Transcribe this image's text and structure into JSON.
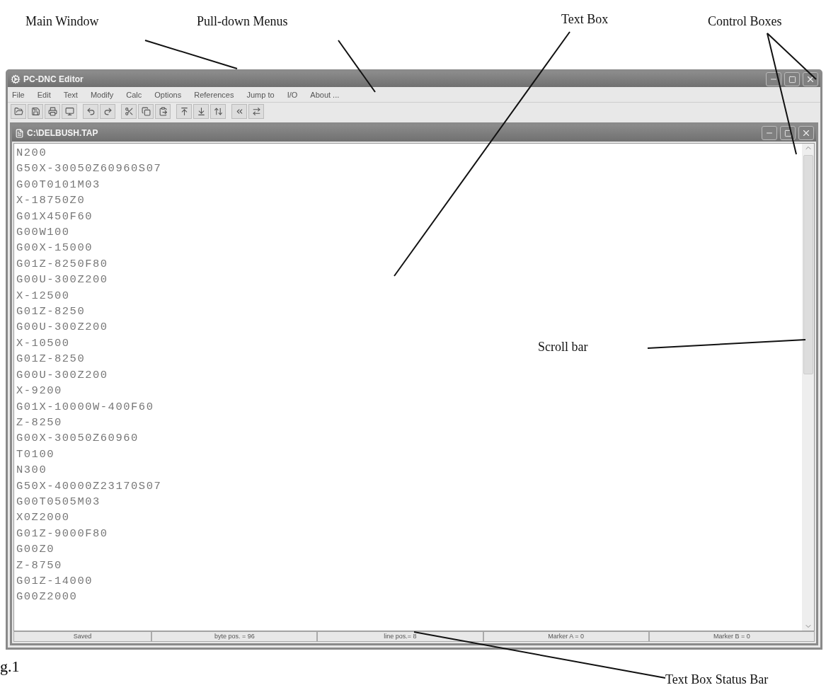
{
  "annotations": [
    "Main Window",
    "Pull-down Menus",
    "Text Box",
    "Control Boxes",
    "Scroll bar",
    "Text Box Status Bar"
  ],
  "figure_caption": "g.1",
  "main_window": {
    "title": "PC-DNC Editor",
    "menus": [
      "File",
      "Edit",
      "Text",
      "Modify",
      "Calc",
      "Options",
      "References",
      "Jump to",
      "I/O",
      "About ..."
    ]
  },
  "document_window": {
    "title": "C:\\DELBUSH.TAP",
    "lines": [
      "N200",
      "G50X-30050Z60960S07",
      "G00T0101M03",
      "X-18750Z0",
      "G01X450F60",
      "G00W100",
      "G00X-15000",
      "G01Z-8250F80",
      "G00U-300Z200",
      "X-12500",
      "G01Z-8250",
      "G00U-300Z200",
      "X-10500",
      "G01Z-8250",
      "G00U-300Z200",
      "X-9200",
      "G01X-10000W-400F60",
      "Z-8250",
      "G00X-30050Z60960",
      "T0100",
      "N300",
      "G50X-40000Z23170S07",
      "G00T0505M03",
      "X0Z2000",
      "G01Z-9000F80",
      "G00Z0",
      "Z-8750",
      "G01Z-14000",
      "G00Z2000"
    ],
    "status_bar": [
      "Saved",
      "byte pos. = 96",
      "line pos.= 8",
      "Marker A = 0",
      "Marker B = 0"
    ]
  }
}
